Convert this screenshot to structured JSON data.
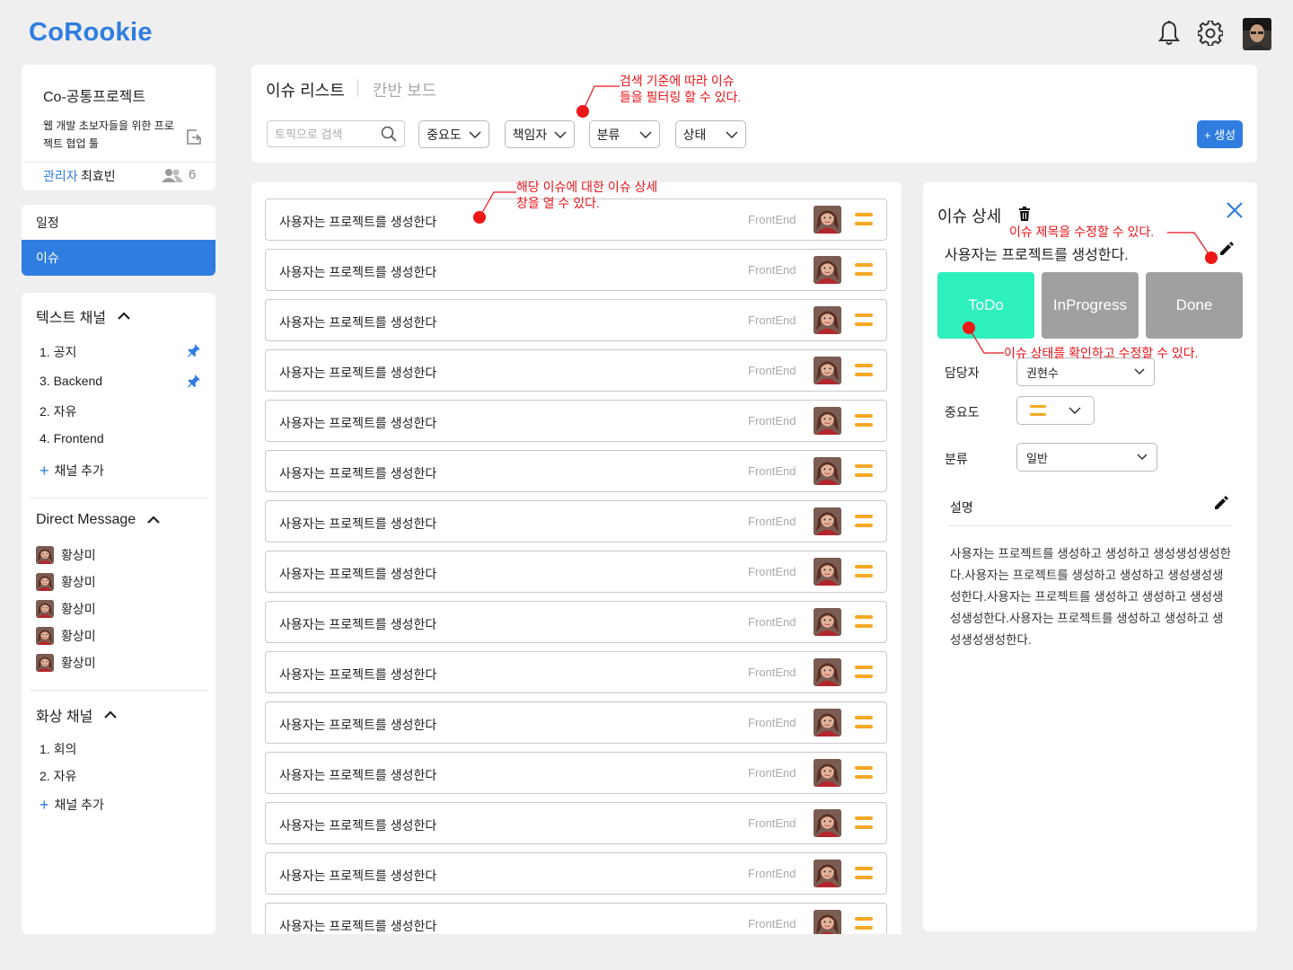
{
  "app": {
    "logo": "CoRookie"
  },
  "header": {
    "icons": [
      "bell-icon",
      "gear-icon",
      "avatar"
    ]
  },
  "project": {
    "title": "Co-공통프로젝트",
    "description": "웹 개발 초보자들을 위한 프로젝트 협업 툴",
    "admin_label": "관리자",
    "admin_name": "최효빈",
    "member_count": "6"
  },
  "nav": {
    "schedule": "일정",
    "issue": "이슈"
  },
  "text_channels": {
    "title": "텍스트 채널",
    "items": [
      "1. 공지",
      "3. Backend",
      "2. 자유",
      "4. Frontend"
    ],
    "pinned": [
      true,
      true,
      false,
      false
    ],
    "add_label": "채널 추가"
  },
  "direct_message": {
    "title": "Direct Message",
    "items": [
      "황상미",
      "황상미",
      "황상미",
      "황상미",
      "황상미"
    ]
  },
  "video_channels": {
    "title": "화상 채널",
    "items": [
      "1. 회의",
      "2. 자유"
    ],
    "add_label": "채널 추가"
  },
  "toolbar": {
    "tabs": {
      "list": "이슈 리스트",
      "kanban": "칸반 보드"
    },
    "search_placeholder": "토픽으로 검색",
    "filters": [
      "중요도",
      "책임자",
      "분류",
      "상태"
    ],
    "create_label": "+ 생성"
  },
  "issues": [
    {
      "title": "사용자는 프로젝트를 생성한다",
      "category": "FrontEnd"
    },
    {
      "title": "사용자는 프로젝트를 생성한다",
      "category": "FrontEnd"
    },
    {
      "title": "사용자는 프로젝트를 생성한다",
      "category": "FrontEnd"
    },
    {
      "title": "사용자는 프로젝트를 생성한다",
      "category": "FrontEnd"
    },
    {
      "title": "사용자는 프로젝트를 생성한다",
      "category": "FrontEnd"
    },
    {
      "title": "사용자는 프로젝트를 생성한다",
      "category": "FrontEnd"
    },
    {
      "title": "사용자는 프로젝트를 생성한다",
      "category": "FrontEnd"
    },
    {
      "title": "사용자는 프로젝트를 생성한다",
      "category": "FrontEnd"
    },
    {
      "title": "사용자는 프로젝트를 생성한다",
      "category": "FrontEnd"
    },
    {
      "title": "사용자는 프로젝트를 생성한다",
      "category": "FrontEnd"
    },
    {
      "title": "사용자는 프로젝트를 생성한다",
      "category": "FrontEnd"
    },
    {
      "title": "사용자는 프로젝트를 생성한다",
      "category": "FrontEnd"
    },
    {
      "title": "사용자는 프로젝트를 생성한다",
      "category": "FrontEnd"
    },
    {
      "title": "사용자는 프로젝트를 생성한다",
      "category": "FrontEnd"
    },
    {
      "title": "사용자는 프로젝트를 생성한다",
      "category": "FrontEnd"
    }
  ],
  "detail": {
    "heading": "이슈 상세",
    "issue_title": "사용자는 프로젝트를 생성한다.",
    "statuses": [
      "ToDo",
      "InProgress",
      "Done"
    ],
    "status_colors": [
      "#2ef0bd",
      "#a0a0a0",
      "#a0a0a0"
    ],
    "assignee_label": "담당자",
    "assignee_value": "권현수",
    "priority_label": "중요도",
    "category_label": "분류",
    "category_value": "일반",
    "description_label": "설명",
    "description": "사용자는 프로젝트를 생성하고 생성하고 생성생성생성한다.사용자는 프로젝트를 생성하고 생성하고 생성생성생성한다.사용자는 프로젝트를 생성하고 생성하고 생성생성생성한다.사용자는 프로젝트를 생성하고 생성하고 생성생성생성한다."
  },
  "annotations": {
    "filter": "검색 기준에 따라 이슈\n들을 필터링 할 수 있다.",
    "open_detail": "해당 이슈에 대한 이슈 상세\n창을 열 수 있다.",
    "edit_title": "이슈 제목을 수정할 수 있다.",
    "edit_status": "이슈 상태를 확인하고 수정할 수 있다."
  },
  "colors": {
    "accent": "#2f7de0",
    "priority": "#f7a823",
    "annotation": "#e8141a",
    "todo": "#2ef0bd"
  }
}
